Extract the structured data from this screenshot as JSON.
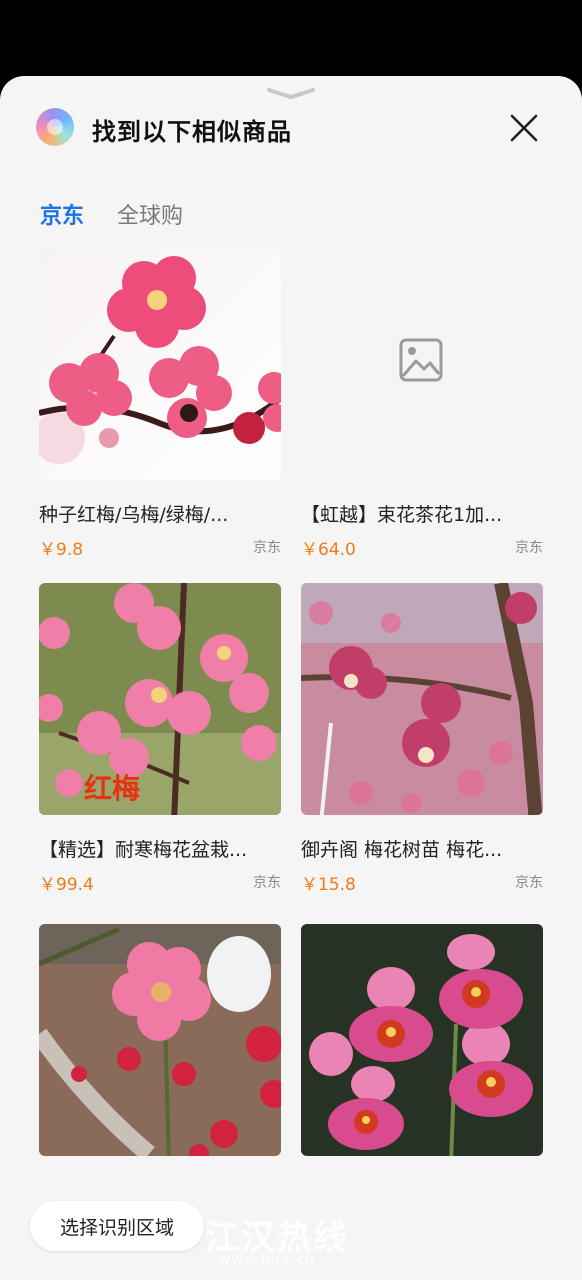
{
  "header": {
    "title": "找到以下相似商品"
  },
  "tabs": [
    {
      "label": "京东",
      "active": true
    },
    {
      "label": "全球购",
      "active": false
    }
  ],
  "products": [
    {
      "name": "种子红梅/乌梅/绿梅/...",
      "price": "￥9.8",
      "store": "京东",
      "image": "pink-plum-blossom-with-bee"
    },
    {
      "name": "【虹越】束花茶花1加...",
      "price": "￥64.0",
      "store": "京东",
      "image": "image-placeholder-icon"
    },
    {
      "name": "【精选】耐寒梅花盆栽...",
      "price": "￥99.4",
      "store": "京东",
      "image": "plum-blossom-branch-red-label",
      "image_text": "红梅"
    },
    {
      "name": "御卉阁 梅花树苗 梅花...",
      "price": "￥15.8",
      "store": "京东",
      "image": "plum-blossom-tree-branch"
    },
    {
      "name": "",
      "price": "",
      "store": "",
      "image": "pink-plum-blossom-potted"
    },
    {
      "name": "",
      "price": "",
      "store": "",
      "image": "pink-orchids-dark-background"
    }
  ],
  "footer": {
    "select_region_label": "选择识别区域"
  },
  "watermark": {
    "text": "江汉热线",
    "url": "www.jhrx.cn"
  },
  "colors": {
    "accent": "#1a73e8",
    "price": "#f07b16",
    "sheet_background": "#f5f5f5"
  }
}
